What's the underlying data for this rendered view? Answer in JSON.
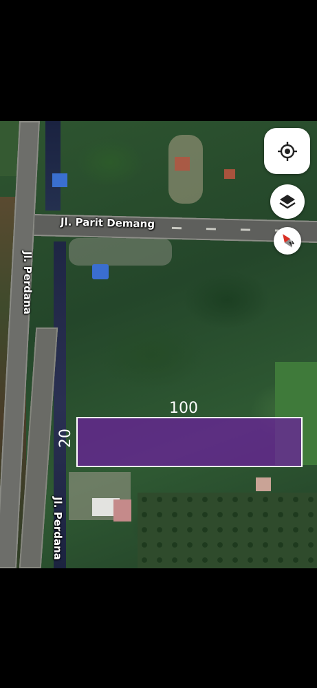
{
  "map": {
    "street_labels": {
      "horizontal_road": "Jl. Parit Demang",
      "vertical_road_upper": "Jl. Perdana",
      "vertical_road_lower": "Jl. Perdana"
    },
    "plot": {
      "length_label": "100",
      "width_label": "20",
      "fill_color": "#6e1ea0",
      "border_color": "#ffffff"
    }
  },
  "controls": {
    "locate": "my-location-icon",
    "layers": "layers-icon",
    "compass": "compass-icon"
  }
}
